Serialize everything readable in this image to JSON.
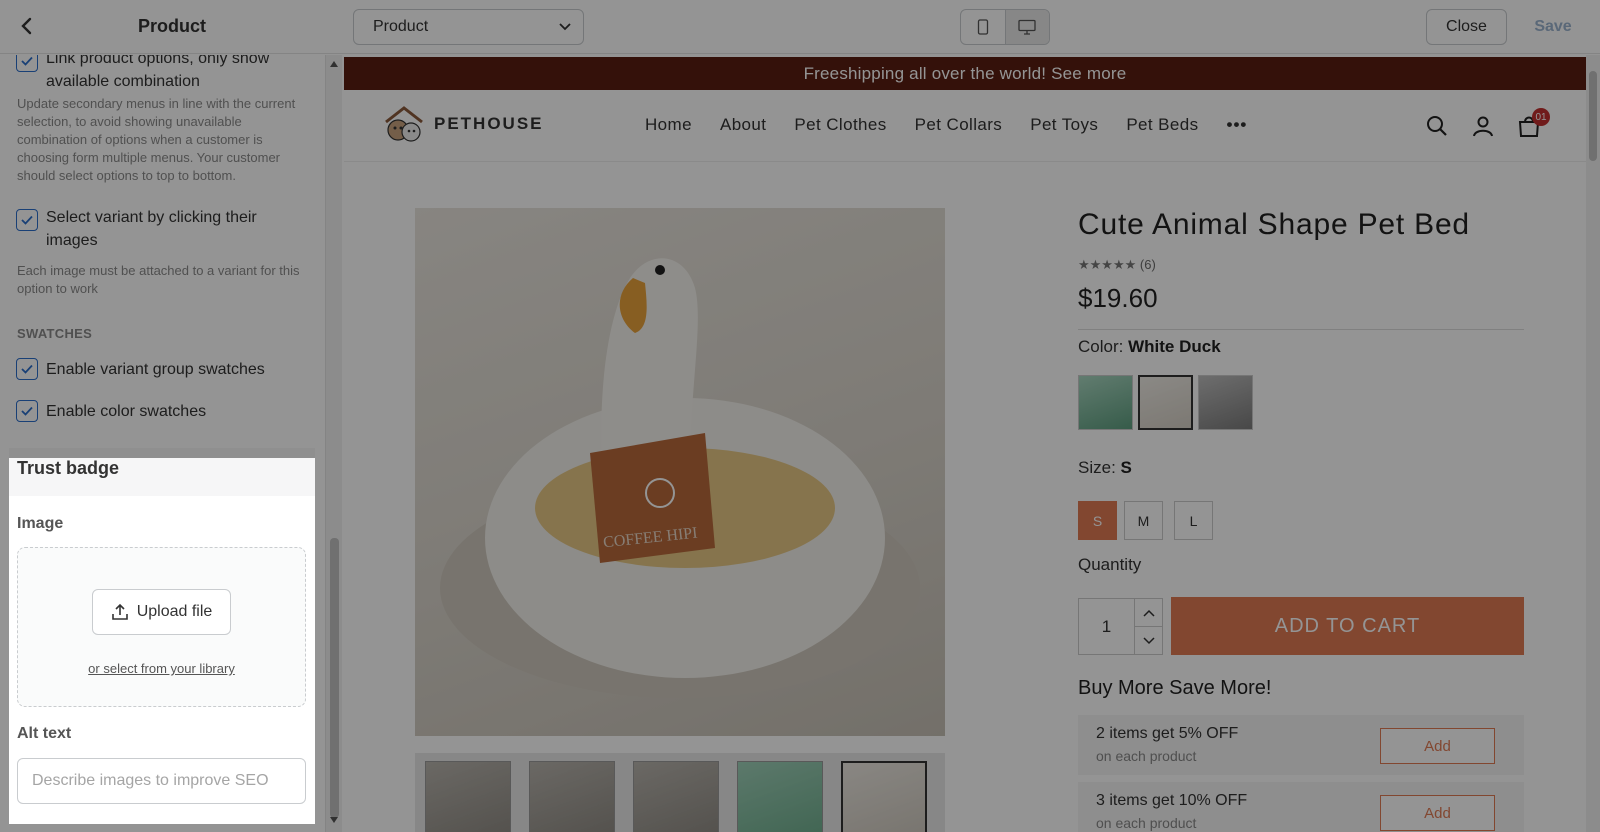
{
  "topbar": {
    "title": "Product",
    "page_select": "Product",
    "close_label": "Close",
    "save_label": "Save"
  },
  "sidebar": {
    "link_options": {
      "label": "Link product options, only show available combination",
      "help": "Update secondary menus in line with the current selection, to avoid showing unavailable combination of options when a customer is choosing form multiple menus. Your customer should select options to top to bottom."
    },
    "select_variant": {
      "label": "Select variant by clicking their images",
      "help": "Each image must be attached to a variant for this option to work"
    },
    "swatches_heading": "SWATCHES",
    "variant_group_swatches": "Enable variant group swatches",
    "color_swatches": "Enable color swatches",
    "trust_badge": {
      "title": "Trust badge",
      "image_label": "Image",
      "upload_label": "Upload file",
      "library_link": "or select from your library",
      "alt_label": "Alt text",
      "alt_placeholder": "Describe images to improve SEO"
    }
  },
  "preview": {
    "announcement": "Freeshipping all over the world! See more",
    "logo_text": "PETHOUSE",
    "nav": [
      "Home",
      "About",
      "Pet Clothes",
      "Pet Collars",
      "Pet Toys",
      "Pet Beds"
    ],
    "cart_count": "01",
    "product": {
      "title": "Cute Animal Shape Pet Bed",
      "rating_count": "(6)",
      "price": "$19.60",
      "color_label": "Color:",
      "color_value": "White Duck",
      "size_label": "Size:",
      "size_value": "S",
      "sizes": [
        "S",
        "M",
        "L"
      ],
      "quantity_label": "Quantity",
      "quantity": "1",
      "add_to_cart": "ADD TO CART",
      "bundle_heading": "Buy More Save More!",
      "offers": [
        {
          "title": "2 items get 5% OFF",
          "sub": "on each product",
          "button": "Add"
        },
        {
          "title": "3 items get 10% OFF",
          "sub": "on each product",
          "button": "Add"
        }
      ],
      "image_text": "COFFEE HIPI"
    }
  },
  "colors": {
    "accent": "#e07a54",
    "announcement_bg": "#5a1e12",
    "checkbox": "#2c6ecb"
  }
}
